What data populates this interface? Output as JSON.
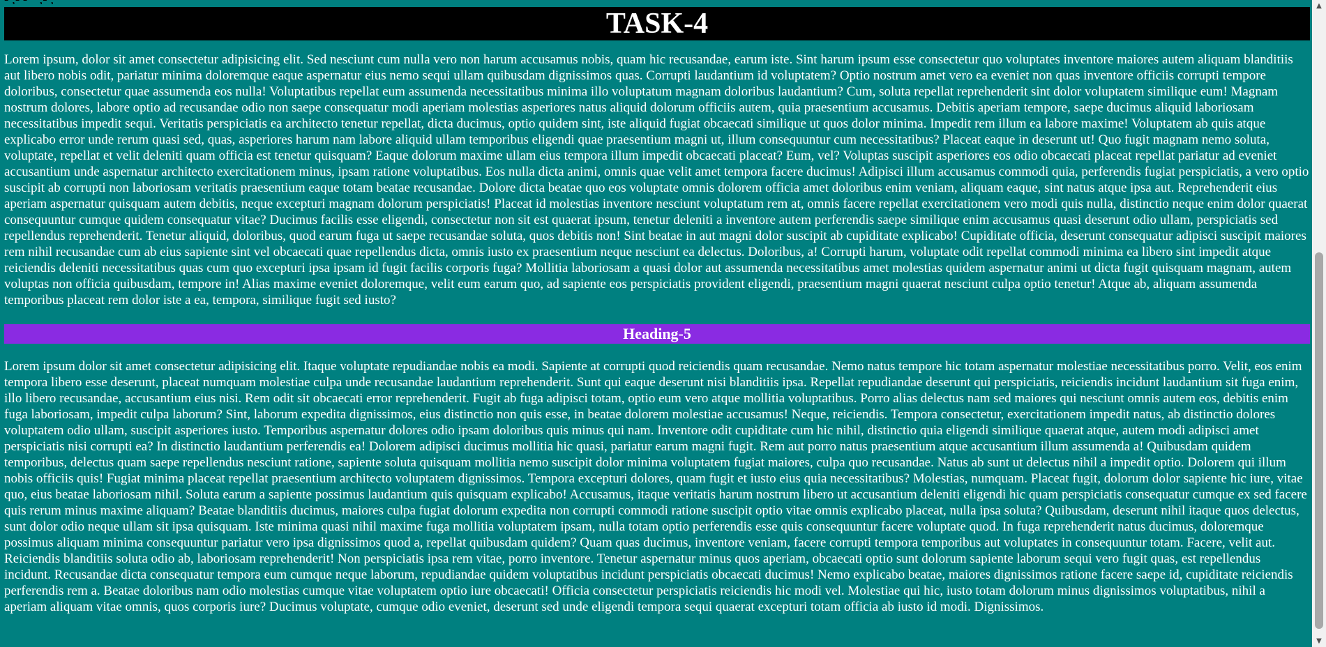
{
  "clipped_top_text": "- ,- - \" ,- ,",
  "title": "TASK-4",
  "paragraph_1": "Lorem ipsum, dolor sit amet consectetur adipisicing elit. Sed nesciunt cum nulla vero non harum accusamus nobis, quam hic recusandae, earum iste. Sint harum ipsum esse consectetur quo voluptates inventore maiores autem aliquam blanditiis aut libero nobis odit, pariatur minima doloremque eaque aspernatur eius nemo sequi ullam quibusdam dignissimos quas. Corrupti laudantium id voluptatem? Optio nostrum amet vero ea eveniet non quas inventore officiis corrupti tempore doloribus, consectetur quae assumenda eos nulla! Voluptatibus repellat eum assumenda necessitatibus minima illo voluptatum magnam doloribus laudantium? Cum, soluta repellat reprehenderit sint dolor voluptatem similique eum! Magnam nostrum dolores, labore optio ad recusandae odio non saepe consequatur modi aperiam molestias asperiores natus aliquid dolorum officiis autem, quia praesentium accusamus. Debitis aperiam tempore, saepe ducimus aliquid laboriosam necessitatibus impedit sequi. Veritatis perspiciatis ea architecto tenetur repellat, dicta ducimus, optio quidem sint, iste aliquid fugiat obcaecati similique ut quos dolor minima. Impedit rem illum ea labore maxime! Voluptatem ab quis atque explicabo error unde rerum quasi sed, quas, asperiores harum nam labore aliquid ullam temporibus eligendi quae praesentium magni ut, illum consequuntur cum necessitatibus? Placeat eaque in deserunt ut! Quo fugit magnam nemo soluta, voluptate, repellat et velit deleniti quam officia est tenetur quisquam? Eaque dolorum maxime ullam eius tempora illum impedit obcaecati placeat? Eum, vel? Voluptas suscipit asperiores eos odio obcaecati placeat repellat pariatur ad eveniet accusantium unde aspernatur architecto exercitationem minus, ipsam ratione voluptatibus. Eos nulla dicta animi, omnis quae velit amet tempora facere ducimus! Adipisci illum accusamus commodi quia, perferendis fugiat perspiciatis, a vero optio suscipit ab corrupti non laboriosam veritatis praesentium eaque totam beatae recusandae. Dolore dicta beatae quo eos voluptate omnis dolorem officia amet doloribus enim veniam, aliquam eaque, sint natus atque ipsa aut. Reprehenderit eius aperiam aspernatur quisquam autem debitis, neque excepturi magnam dolorum perspiciatis! Placeat id molestias inventore nesciunt voluptatum rem at, omnis facere repellat exercitationem vero modi quis nulla, distinctio neque enim dolor quaerat consequuntur cumque quidem consequatur vitae? Ducimus facilis esse eligendi, consectetur non sit est quaerat ipsum, tenetur deleniti a inventore autem perferendis saepe similique enim accusamus quasi deserunt odio ullam, perspiciatis sed repellendus reprehenderit. Tenetur aliquid, doloribus, quod earum fuga ut saepe recusandae soluta, quos debitis non! Sint beatae in aut magni dolor suscipit ab cupiditate explicabo! Cupiditate officia, deserunt consequatur adipisci suscipit maiores rem nihil recusandae cum ab eius sapiente sint vel obcaecati quae repellendus dicta, omnis iusto ex praesentium neque nesciunt ea delectus. Doloribus, a! Corrupti harum, voluptate odit repellat commodi minima ea libero sint impedit atque reiciendis deleniti necessitatibus quas cum quo excepturi ipsa ipsam id fugit facilis corporis fuga? Mollitia laboriosam a quasi dolor aut assumenda necessitatibus amet molestias quidem aspernatur animi ut dicta fugit quisquam magnam, autem voluptas non officia quibusdam, tempore in! Alias maxime eveniet doloremque, velit eum earum quo, ad sapiente eos perspiciatis provident eligendi, praesentium magni quaerat nesciunt culpa optio tenetur! Atque ab, aliquam assumenda temporibus placeat rem dolor iste a ea, tempora, similique fugit sed iusto?",
  "heading": "Heading-5",
  "paragraph_2": "Lorem ipsum dolor sit amet consectetur adipisicing elit. Itaque voluptate repudiandae nobis ea modi. Sapiente at corrupti quod reiciendis quam recusandae. Nemo natus tempore hic totam aspernatur molestiae necessitatibus porro. Velit, eos enim tempora libero esse deserunt, placeat numquam molestiae culpa unde recusandae laudantium reprehenderit. Sunt qui eaque deserunt nisi blanditiis ipsa. Repellat repudiandae deserunt qui perspiciatis, reiciendis incidunt laudantium sit fuga enim, illo libero recusandae, accusantium eius nisi. Rem odit sit obcaecati error reprehenderit. Fugit ab fuga adipisci totam, optio eum vero atque mollitia voluptatibus. Porro alias delectus nam sed maiores qui nesciunt omnis autem eos, debitis enim fuga laboriosam, impedit culpa laborum? Sint, laborum expedita dignissimos, eius distinctio non quis esse, in beatae dolorem molestiae accusamus! Neque, reiciendis. Tempora consectetur, exercitationem impedit natus, ab distinctio dolores voluptatem odio ullam, suscipit asperiores iusto. Temporibus aspernatur dolores odio ipsam doloribus quis minus qui nam. Inventore odit cupiditate cum hic nihil, distinctio quia eligendi similique quaerat atque, autem modi adipisci amet perspiciatis nisi corrupti ea? In distinctio laudantium perferendis ea! Dolorem adipisci ducimus mollitia hic quasi, pariatur earum magni fugit. Rem aut porro natus praesentium atque accusantium illum assumenda a! Quibusdam quidem temporibus, delectus quam saepe repellendus nesciunt ratione, sapiente soluta quisquam mollitia nemo suscipit dolor minima voluptatem fugiat maiores, culpa quo recusandae. Natus ab sunt ut delectus nihil a impedit optio. Dolorem qui illum nobis officiis quis! Fugiat minima placeat repellat praesentium architecto voluptatem dignissimos. Tempora excepturi dolores, quam fugit et iusto eius quia necessitatibus? Molestias, numquam. Placeat fugit, dolorum dolor sapiente hic iure, vitae quo, eius beatae laboriosam nihil. Soluta earum a sapiente possimus laudantium quis quisquam explicabo! Accusamus, itaque veritatis harum nostrum libero ut accusantium deleniti eligendi hic quam perspiciatis consequatur cumque ex sed facere quis rerum minus maxime aliquam? Beatae blanditiis ducimus, maiores culpa fugiat dolorum expedita non corrupti commodi ratione suscipit optio vitae omnis explicabo placeat, nulla ipsa soluta? Quibusdam, deserunt nihil itaque quos delectus, sunt dolor odio neque ullam sit ipsa quisquam. Iste minima quasi nihil maxime fuga mollitia voluptatem ipsam, nulla totam optio perferendis esse quis consequuntur facere voluptate quod. In fuga reprehenderit natus ducimus, doloremque possimus aliquam minima consequuntur pariatur vero ipsa dignissimos quod a, repellat quibusdam quidem? Quam quas ducimus, inventore veniam, facere corrupti tempora temporibus aut voluptates in consequuntur totam. Facere, velit aut. Reiciendis blanditiis soluta odio ab, laboriosam reprehenderit! Non perspiciatis ipsa rem vitae, porro inventore. Tenetur aspernatur minus quos aperiam, obcaecati optio sunt dolorum sapiente laborum sequi vero fugit quas, est repellendus incidunt. Recusandae dicta consequatur tempora eum cumque neque laborum, repudiandae quidem voluptatibus incidunt perspiciatis obcaecati ducimus! Nemo explicabo beatae, maiores dignissimos ratione facere saepe id, cupiditate reiciendis perferendis rem a. Beatae doloribus nam odio molestias cumque vitae voluptatem optio iure obcaecati! Officia consectetur perspiciatis reiciendis hic modi vel. Molestiae qui hic, iusto totam dolorum minus dignissimos voluptatibus, nihil a aperiam aliquam vitae omnis, quos corporis iure? Ducimus voluptate, cumque odio eveniet, deserunt sed unde eligendi tempora sequi quaerat excepturi totam officia ab iusto id modi. Dignissimos.",
  "colors": {
    "page_background": "#008080",
    "title_background": "#000000",
    "heading_background": "#8a2be2",
    "text": "#ffffff"
  },
  "scrollbar": {
    "scroll_position": 0.95
  }
}
